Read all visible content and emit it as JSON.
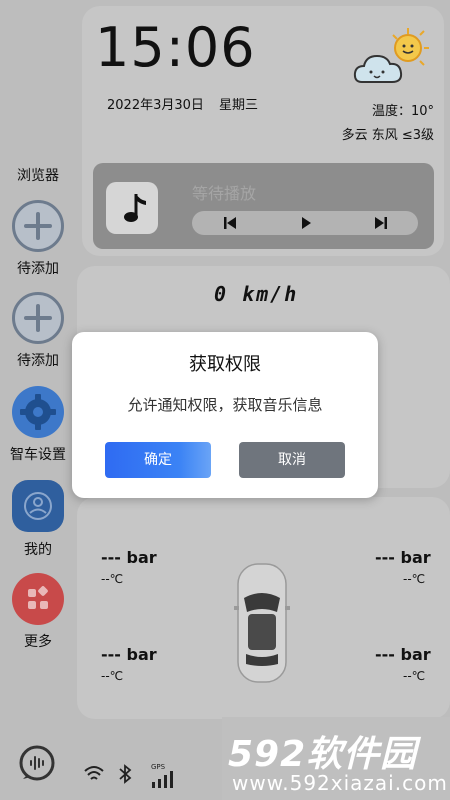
{
  "sidebar": {
    "browser_label": "浏览器",
    "items": [
      {
        "label": "待添加"
      },
      {
        "label": "待添加"
      },
      {
        "label": "智车设置"
      },
      {
        "label": "我的"
      },
      {
        "label": "更多"
      }
    ]
  },
  "clock": {
    "time": "15:06",
    "date": "2022年3月30日",
    "weekday": "星期三"
  },
  "weather": {
    "temperature": "温度：10°",
    "condition": "多云  东风  ≤3级",
    "icon": "cloud-sun-icon"
  },
  "music": {
    "status": "等待播放"
  },
  "speed": {
    "value": "0 km/h"
  },
  "tires": {
    "front_left": {
      "pressure": "--- bar",
      "temp": "--℃"
    },
    "front_right": {
      "pressure": "--- bar",
      "temp": "--℃"
    },
    "rear_left": {
      "pressure": "--- bar",
      "temp": "--℃"
    },
    "rear_right": {
      "pressure": "--- bar",
      "temp": "--℃"
    }
  },
  "status_bar": {
    "gps_label": "GPS"
  },
  "dialog": {
    "title": "获取权限",
    "message": "允许通知权限，获取音乐信息",
    "confirm": "确定",
    "cancel": "取消"
  },
  "watermark": {
    "brand": "592软件园",
    "url": "www.592xiazai.com"
  },
  "colors": {
    "confirm_button": "#3a7df5",
    "cancel_button": "#6f757d",
    "gear_icon_bg": "#3d78c9",
    "user_icon_bg": "#2f5f9e",
    "more_icon_bg": "#c84a4a",
    "overlay_background": "#bdbdbd"
  }
}
